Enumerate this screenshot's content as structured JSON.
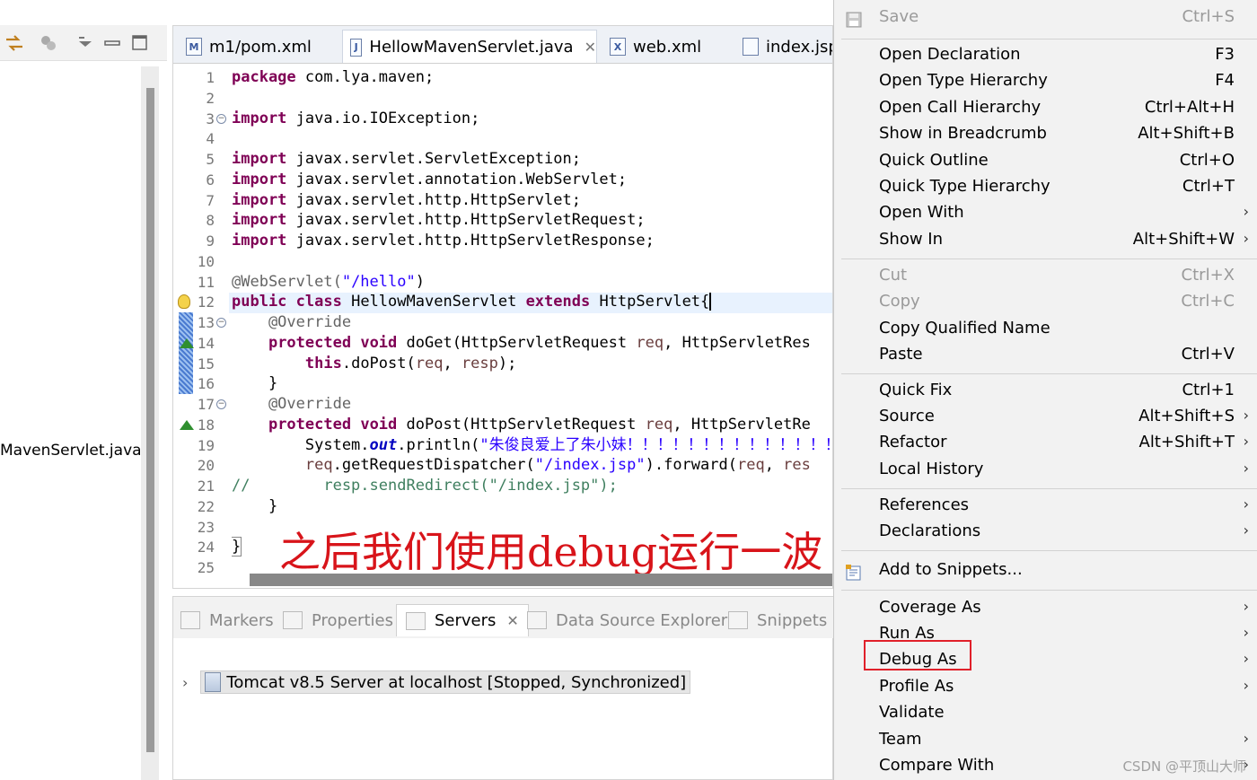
{
  "left_pane": {
    "file_label": "MavenServlet.java"
  },
  "editor": {
    "tabs": [
      {
        "label": "m1/pom.xml",
        "icon": "maven-pom-icon",
        "icon_text": "M"
      },
      {
        "label": "HellowMavenServlet.java",
        "icon": "java-file-icon",
        "icon_text": "J",
        "active": true
      },
      {
        "label": "web.xml",
        "icon": "xml-file-icon",
        "icon_text": "X"
      },
      {
        "label": "index.jsp",
        "icon": "jsp-file-icon",
        "icon_text": ""
      }
    ],
    "line_numbers": [
      "1",
      "2",
      "3",
      "4",
      "5",
      "6",
      "7",
      "8",
      "9",
      "10",
      "11",
      "12",
      "13",
      "14",
      "15",
      "16",
      "17",
      "18",
      "19",
      "20",
      "21",
      "22",
      "23",
      "24",
      "25"
    ],
    "code_lines": [
      [
        {
          "t": "package",
          "c": "kw"
        },
        {
          "t": " com.lya.maven;",
          "c": ""
        }
      ],
      [],
      [
        {
          "t": "import",
          "c": "kw"
        },
        {
          "t": " java.io.IOException;",
          "c": ""
        }
      ],
      [],
      [
        {
          "t": "import",
          "c": "kw"
        },
        {
          "t": " javax.servlet.ServletException;",
          "c": ""
        }
      ],
      [
        {
          "t": "import",
          "c": "kw"
        },
        {
          "t": " javax.servlet.annotation.WebServlet;",
          "c": ""
        }
      ],
      [
        {
          "t": "import",
          "c": "kw"
        },
        {
          "t": " javax.servlet.http.HttpServlet;",
          "c": ""
        }
      ],
      [
        {
          "t": "import",
          "c": "kw"
        },
        {
          "t": " javax.servlet.http.HttpServletRequest;",
          "c": ""
        }
      ],
      [
        {
          "t": "import",
          "c": "kw"
        },
        {
          "t": " javax.servlet.http.HttpServletResponse;",
          "c": ""
        }
      ],
      [],
      [
        {
          "t": "@WebServlet(",
          "c": "ann"
        },
        {
          "t": "\"/hello\"",
          "c": "str"
        },
        {
          "t": ")",
          "c": ""
        }
      ],
      [
        {
          "t": "public",
          "c": "kw"
        },
        {
          "t": " ",
          "c": ""
        },
        {
          "t": "class",
          "c": "kw"
        },
        {
          "t": " HellowMavenServlet ",
          "c": ""
        },
        {
          "t": "extends",
          "c": "kw"
        },
        {
          "t": " HttpServlet{",
          "c": ""
        }
      ],
      [
        {
          "t": "    @Override",
          "c": "ann"
        }
      ],
      [
        {
          "t": "    ",
          "c": ""
        },
        {
          "t": "protected",
          "c": "kw"
        },
        {
          "t": " ",
          "c": ""
        },
        {
          "t": "void",
          "c": "kw"
        },
        {
          "t": " doGet(HttpServletRequest ",
          "c": ""
        },
        {
          "t": "req",
          "c": "var"
        },
        {
          "t": ", HttpServletRes",
          "c": ""
        }
      ],
      [
        {
          "t": "        ",
          "c": ""
        },
        {
          "t": "this",
          "c": "kw"
        },
        {
          "t": ".doPost(",
          "c": ""
        },
        {
          "t": "req",
          "c": "var"
        },
        {
          "t": ", ",
          "c": ""
        },
        {
          "t": "resp",
          "c": "var"
        },
        {
          "t": ");",
          "c": ""
        }
      ],
      [
        {
          "t": "    }",
          "c": ""
        }
      ],
      [
        {
          "t": "    @Override",
          "c": "ann"
        }
      ],
      [
        {
          "t": "    ",
          "c": ""
        },
        {
          "t": "protected",
          "c": "kw"
        },
        {
          "t": " ",
          "c": ""
        },
        {
          "t": "void",
          "c": "kw"
        },
        {
          "t": " doPost(HttpServletRequest ",
          "c": ""
        },
        {
          "t": "req",
          "c": "var"
        },
        {
          "t": ", HttpServletRe",
          "c": ""
        }
      ],
      [
        {
          "t": "        System.",
          "c": ""
        },
        {
          "t": "out",
          "c": "field"
        },
        {
          "t": ".println(",
          "c": ""
        },
        {
          "t": "\"朱俊良爱上了朱小妹！！！！！！！！！！！！！！",
          "c": "str"
        }
      ],
      [
        {
          "t": "        ",
          "c": ""
        },
        {
          "t": "req",
          "c": "var"
        },
        {
          "t": ".getRequestDispatcher(",
          "c": ""
        },
        {
          "t": "\"/index.jsp\"",
          "c": "str"
        },
        {
          "t": ").forward(",
          "c": ""
        },
        {
          "t": "req",
          "c": "var"
        },
        {
          "t": ", ",
          "c": ""
        },
        {
          "t": "res",
          "c": "var"
        }
      ],
      [
        {
          "t": "//        resp.sendRedirect(\"/index.jsp\");",
          "c": "cmt"
        }
      ],
      [
        {
          "t": "    }",
          "c": ""
        }
      ],
      [],
      [
        {
          "t": "}",
          "c": ""
        }
      ],
      []
    ],
    "overlay_text": "之后我们使用debug运行一波"
  },
  "bottom_panel": {
    "tabs": [
      {
        "label": "Markers",
        "icon": "markers-icon"
      },
      {
        "label": "Properties",
        "icon": "properties-icon"
      },
      {
        "label": "Servers",
        "icon": "servers-icon",
        "active": true
      },
      {
        "label": "Data Source Explorer",
        "icon": "data-source-icon"
      },
      {
        "label": "Snippets",
        "icon": "snippets-icon"
      }
    ],
    "server_entry": "Tomcat v8.5 Server at localhost  [Stopped, Synchronized]"
  },
  "context_menu": {
    "items": [
      {
        "label": "Save",
        "shortcut": "Ctrl+S",
        "disabled": true,
        "icon": "save-icon"
      },
      {
        "sep": true
      },
      {
        "label": "Open Declaration",
        "shortcut": "F3"
      },
      {
        "label": "Open Type Hierarchy",
        "shortcut": "F4"
      },
      {
        "label": "Open Call Hierarchy",
        "shortcut": "Ctrl+Alt+H"
      },
      {
        "label": "Show in Breadcrumb",
        "shortcut": "Alt+Shift+B"
      },
      {
        "label": "Quick Outline",
        "shortcut": "Ctrl+O"
      },
      {
        "label": "Quick Type Hierarchy",
        "shortcut": "Ctrl+T"
      },
      {
        "label": "Open With",
        "shortcut": "",
        "submenu": true
      },
      {
        "label": "Show In",
        "shortcut": "Alt+Shift+W",
        "submenu": true
      },
      {
        "sep": true
      },
      {
        "label": "Cut",
        "shortcut": "Ctrl+X",
        "disabled": true
      },
      {
        "label": "Copy",
        "shortcut": "Ctrl+C",
        "disabled": true
      },
      {
        "label": "Copy Qualified Name",
        "shortcut": ""
      },
      {
        "label": "Paste",
        "shortcut": "Ctrl+V"
      },
      {
        "sep": true
      },
      {
        "label": "Quick Fix",
        "shortcut": "Ctrl+1"
      },
      {
        "label": "Source",
        "shortcut": "Alt+Shift+S",
        "submenu": true
      },
      {
        "label": "Refactor",
        "shortcut": "Alt+Shift+T",
        "submenu": true
      },
      {
        "label": "Local History",
        "shortcut": "",
        "submenu": true
      },
      {
        "sep": true
      },
      {
        "label": "References",
        "shortcut": "",
        "submenu": true
      },
      {
        "label": "Declarations",
        "shortcut": "",
        "submenu": true
      },
      {
        "sep": true
      },
      {
        "label": "Add to Snippets...",
        "shortcut": "",
        "icon": "snippet-add-icon"
      },
      {
        "sep": true
      },
      {
        "label": "Coverage As",
        "shortcut": "",
        "submenu": true
      },
      {
        "label": "Run As",
        "shortcut": "",
        "submenu": true
      },
      {
        "label": "Debug As",
        "shortcut": "",
        "submenu": true
      },
      {
        "label": "Profile As",
        "shortcut": "",
        "submenu": true
      },
      {
        "label": "Validate",
        "shortcut": ""
      },
      {
        "label": "Team",
        "shortcut": "",
        "submenu": true
      },
      {
        "label": "Compare With",
        "shortcut": "",
        "submenu": true
      }
    ],
    "submenu_arrow": "›"
  },
  "watermark": "CSDN @平顶山大师",
  "colors": {
    "keyword": "#7f0055",
    "string": "#2a00ff",
    "annotation": "#646464",
    "comment": "#3f7f5f",
    "highlight_box": "#e0202a",
    "overlay_text": "#d8141a"
  }
}
